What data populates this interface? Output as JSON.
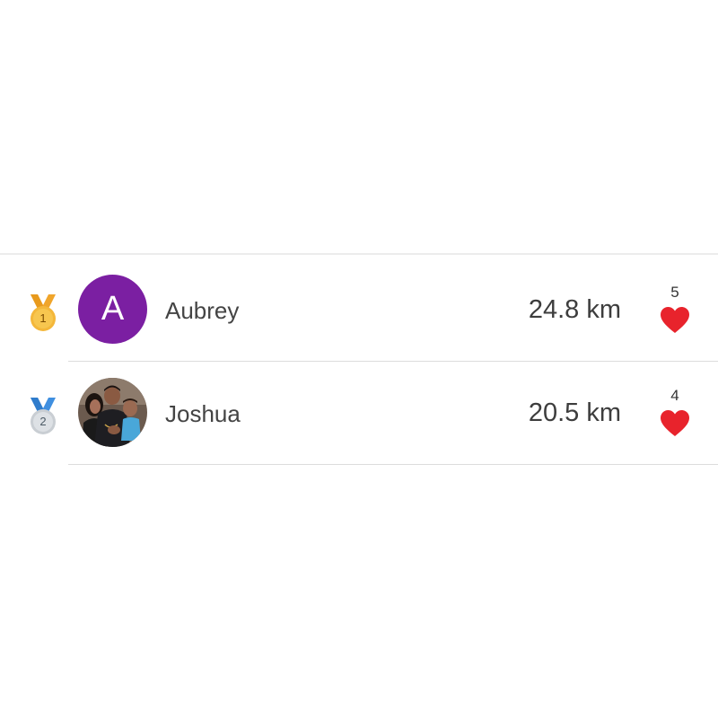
{
  "leaderboard": {
    "rows": [
      {
        "rank": "1",
        "medal": "gold-medal-icon",
        "avatar_letter": "A",
        "avatar_color": "#7b1fa2",
        "name": "Aubrey",
        "distance": "24.8 km",
        "likes": "5"
      },
      {
        "rank": "2",
        "medal": "silver-medal-icon",
        "avatar_letter": "",
        "avatar_type": "photo",
        "name": "Joshua",
        "distance": "20.5 km",
        "likes": "4"
      }
    ]
  },
  "colors": {
    "heart": "#e8232c",
    "gold_medal": "#f4b73a",
    "silver_medal": "#c9ced3",
    "gold_ribbon": "#f0a52b",
    "silver_ribbon": "#3f8fe0"
  }
}
